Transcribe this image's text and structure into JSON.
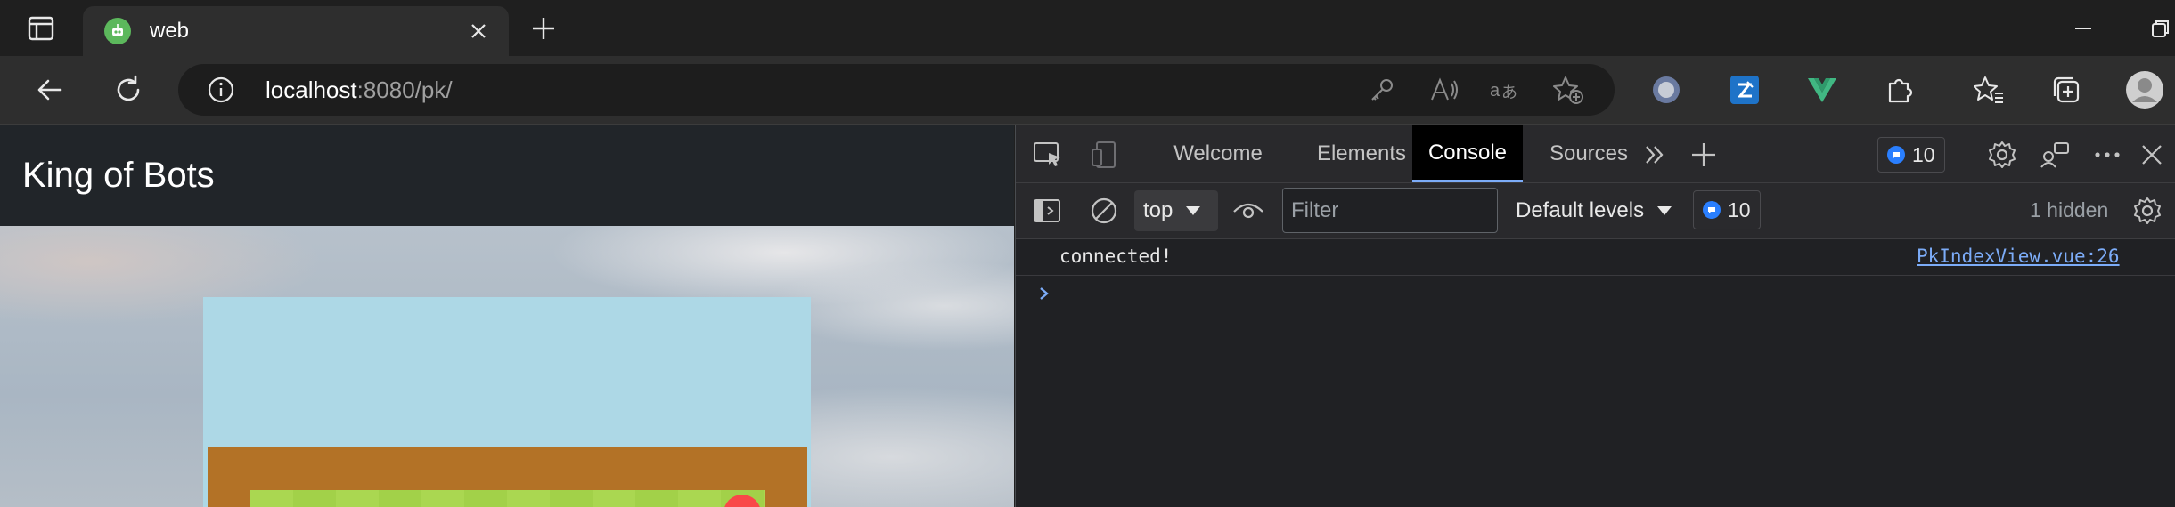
{
  "browser": {
    "tab": {
      "title": "web"
    },
    "address": {
      "host": "localhost",
      "rest": ":8080/pk/"
    }
  },
  "page": {
    "brand": "King of Bots"
  },
  "devtools": {
    "tabs": [
      {
        "label": "Welcome"
      },
      {
        "label": "Elements"
      },
      {
        "label": "Console"
      },
      {
        "label": "Sources"
      }
    ],
    "active_tab": "Console",
    "issues_count": "10",
    "toolbar": {
      "context": "top",
      "filter_placeholder": "Filter",
      "levels": "Default levels",
      "messages_count": "10",
      "hidden": "1 hidden"
    },
    "console": {
      "message": "connected!",
      "source": "PkIndexView.vue:26"
    }
  },
  "colors": {
    "game_background": "#add8e6",
    "map_border": "#b37226",
    "grass_light": "#aad751",
    "grass_dark": "#a2d149",
    "snake_red": "#f94848",
    "link": "#7cacf8"
  }
}
